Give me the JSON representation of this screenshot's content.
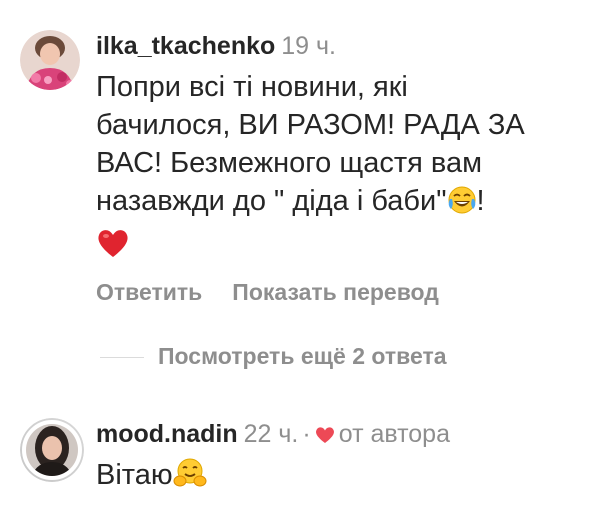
{
  "comments": [
    {
      "username": "ilka_tkachenko",
      "time": "19 ч.",
      "text_lines": [
        "Попри всі ті новини, які",
        "бачилося, ВИ РАЗОМ! РАДА ЗА",
        "ВАС! Безмежного щастя вам",
        "назавжди до \" діда і баби\""
      ],
      "text_tail": "!",
      "emoji_in_text": "face-with-tears-of-joy-icon",
      "extra_line_emoji": "red-heart-icon",
      "reply_label": "Ответить",
      "translate_label": "Показать перевод"
    },
    {
      "username": "mood.nadin",
      "time": "22 ч.",
      "separator": "·",
      "author_label": "от автора",
      "text": "Вітаю",
      "emoji_in_text": "hugging-face-icon"
    }
  ],
  "more_replies_label": "Посмотреть ещё 2 ответа",
  "colors": {
    "text": "#262626",
    "secondary": "#8e8e8e",
    "heart": "#ed4956",
    "divider": "#dbdbdb"
  }
}
